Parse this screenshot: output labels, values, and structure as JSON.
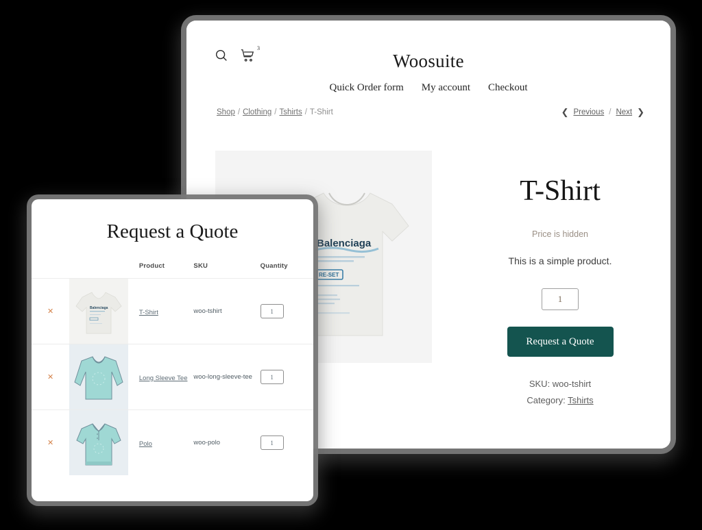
{
  "site": {
    "title": "Woosuite",
    "search_icon": "search-icon",
    "cart_icon": "cart-icon",
    "cart_count": "3"
  },
  "nav": {
    "items": [
      {
        "label": "Quick Order form"
      },
      {
        "label": "My account"
      },
      {
        "label": "Checkout"
      }
    ]
  },
  "breadcrumb": {
    "items": [
      {
        "label": "Shop",
        "link": true
      },
      {
        "label": "Clothing",
        "link": true
      },
      {
        "label": "Tshirts",
        "link": true
      },
      {
        "label": "T-Shirt",
        "link": false
      }
    ],
    "separator": "/"
  },
  "pager": {
    "prev_icon": "chevron-left-icon",
    "prev_label": "Previous",
    "separator": "/",
    "next_label": "Next",
    "next_icon": "chevron-right-icon"
  },
  "product": {
    "image_alt": "balenciaga-tshirt-image",
    "title": "T-Shirt",
    "price": "Price is hidden",
    "description": "This is a simple product.",
    "quantity": "1",
    "cta_label": "Request a Quote",
    "cta_color": "#14544f",
    "sku_label": "SKU: woo-tshirt",
    "category_prefix": "Category:",
    "category_link": "Tshirts"
  },
  "quote": {
    "title": "Request a Quote",
    "columns": {
      "remove": "",
      "thumb": "",
      "product": "Product",
      "sku": "SKU",
      "quantity": "Quantity"
    },
    "remove_glyph": "✕",
    "rows": [
      {
        "name": "T-Shirt",
        "sku": "woo-tshirt",
        "quantity": "1",
        "thumb": "tshirt-white-thumb"
      },
      {
        "name": "Long Sleeve Tee",
        "sku": "woo-long-sleeve-tee",
        "quantity": "1",
        "thumb": "long-sleeve-tee-teal-thumb"
      },
      {
        "name": "Polo",
        "sku": "woo-polo",
        "quantity": "1",
        "thumb": "polo-teal-thumb"
      }
    ]
  }
}
